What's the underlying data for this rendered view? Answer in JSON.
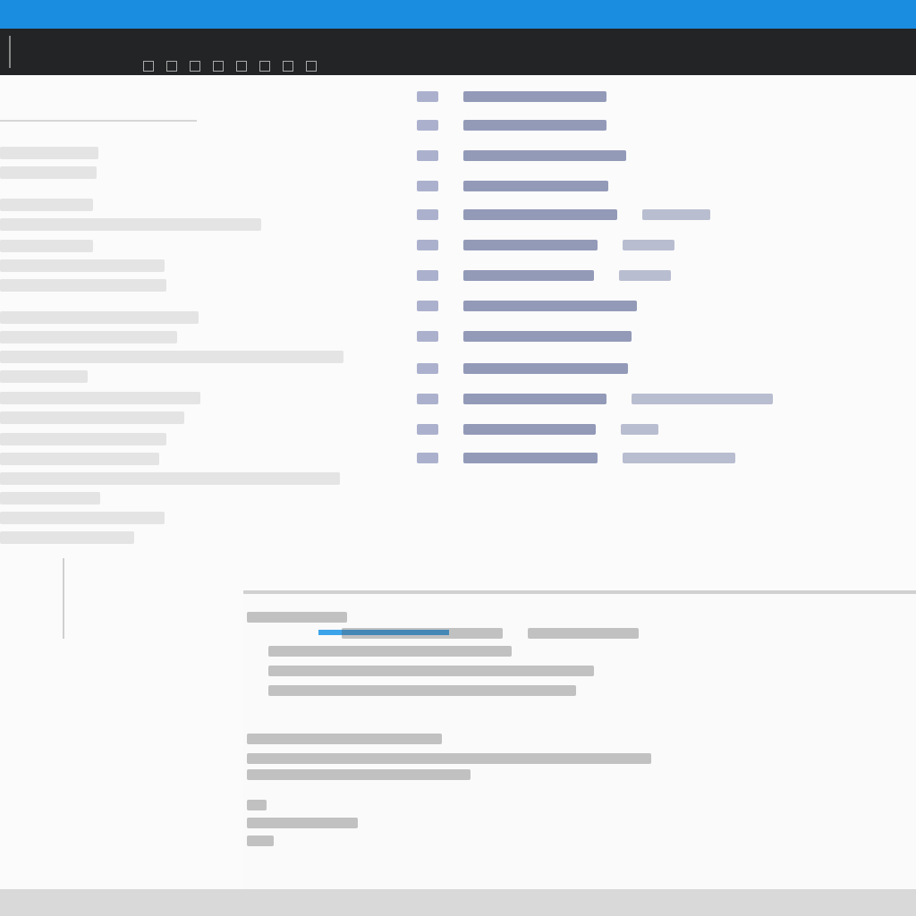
{
  "window": {
    "title": ""
  },
  "toolbar": {
    "tools": []
  },
  "left_pane": {
    "items": []
  },
  "listing": {
    "lines": []
  },
  "bottom_panel": {
    "heading": "",
    "lines": []
  },
  "colors": {
    "title_strip": "#1a8de0",
    "toolbar": "#222426",
    "accent": "#3da4ea",
    "listing_text": "#3e4a82"
  }
}
